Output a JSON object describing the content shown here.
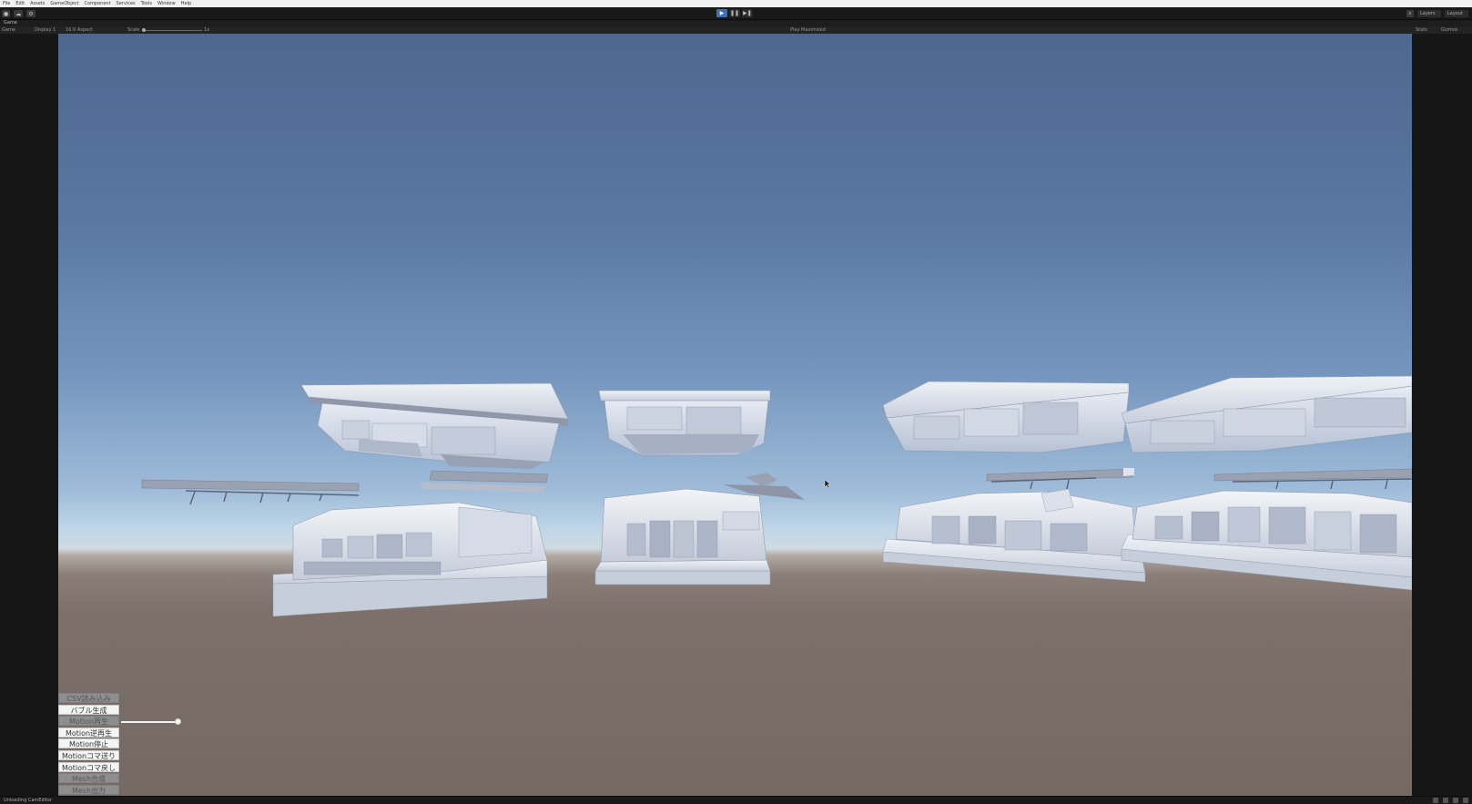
{
  "menu": [
    "File",
    "Edit",
    "Assets",
    "GameObject",
    "Component",
    "Services",
    "Tools",
    "Window",
    "Help"
  ],
  "toolbar": {
    "left_buttons": [
      "account-icon",
      "cloud-icon",
      "settings-icon"
    ],
    "play_controls": [
      "play-icon",
      "pause-icon",
      "step-icon"
    ],
    "right": {
      "layers_label": "Layers",
      "layout_label": "Layout"
    }
  },
  "game_tab": {
    "label": "Game"
  },
  "game_toolbar": {
    "game_dropdown": "Game",
    "display_dropdown": "Display 1",
    "aspect_dropdown": "16:9 Aspect",
    "scale_label": "Scale",
    "scale_value": "1x",
    "play_focused": "Play Maximized",
    "stats_label": "Stats",
    "gizmos_label": "Gizmos"
  },
  "ui_overlay": {
    "buttons": [
      {
        "label": "CSV読み込み",
        "state": "dim"
      },
      {
        "label": "バブル生成",
        "state": "normal"
      },
      {
        "label": "Motion再生",
        "state": "dim"
      },
      {
        "label": "Motion逆再生",
        "state": "normal"
      },
      {
        "label": "Motion停止",
        "state": "normal"
      },
      {
        "label": "Motionコマ送り",
        "state": "normal"
      },
      {
        "label": "Motionコマ戻し",
        "state": "normal"
      },
      {
        "label": "Mesh合成",
        "state": "dim"
      },
      {
        "label": "Mesh出力",
        "state": "dim"
      }
    ],
    "slider_value": 1.0
  },
  "statusbar": {
    "text": "Unloading CamEditor"
  },
  "colors": {
    "accent": "#3c6fb4",
    "sky_top": "#4d6790",
    "ground": "#7c706a",
    "mesh": "#dce2ee"
  }
}
